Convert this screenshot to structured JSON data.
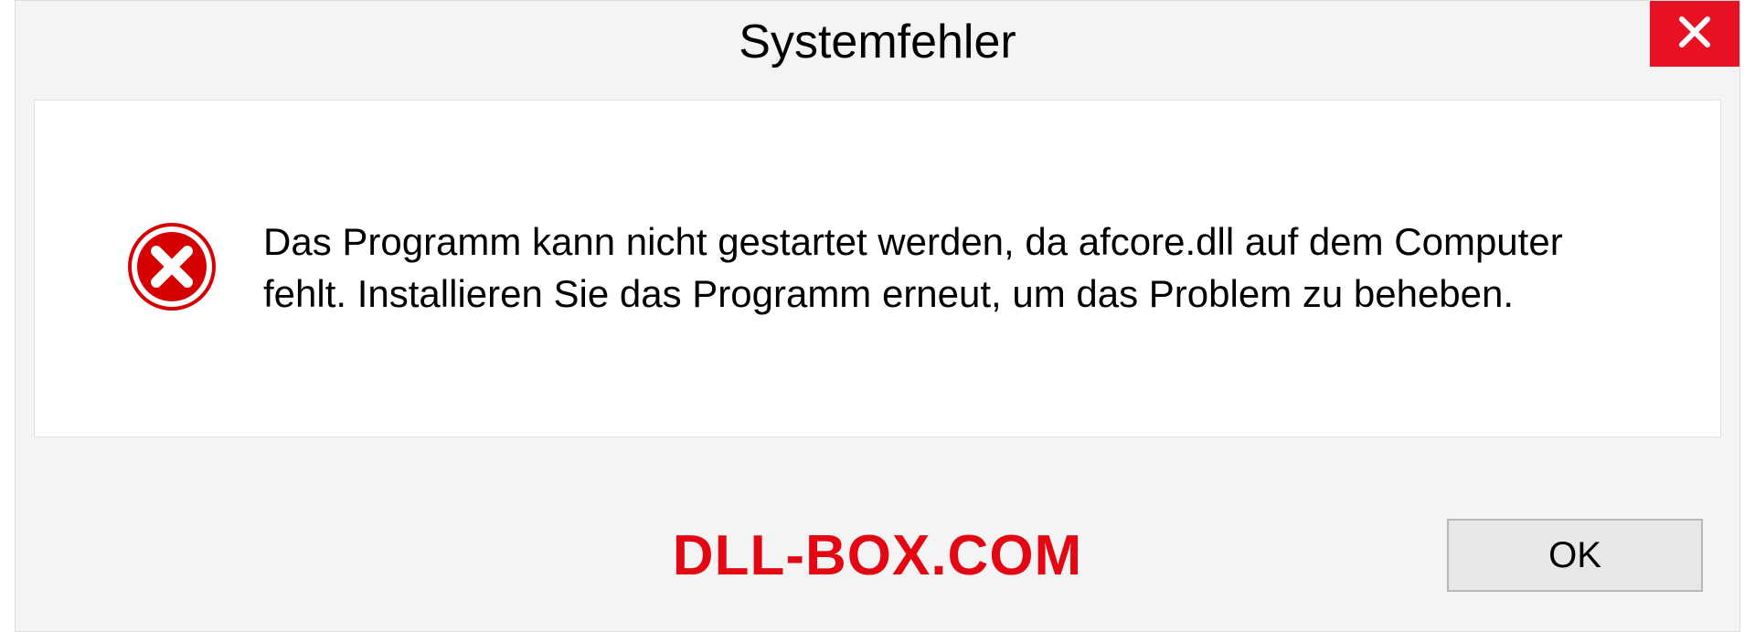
{
  "dialog": {
    "title": "Systemfehler",
    "message": "Das Programm kann nicht gestartet werden, da afcore.dll auf dem Computer fehlt. Installieren Sie das Programm erneut, um das Problem zu beheben.",
    "ok_label": "OK"
  },
  "watermark": "DLL-BOX.COM",
  "colors": {
    "close_red": "#e81123",
    "error_red": "#d50000",
    "watermark_red": "#e30613"
  }
}
